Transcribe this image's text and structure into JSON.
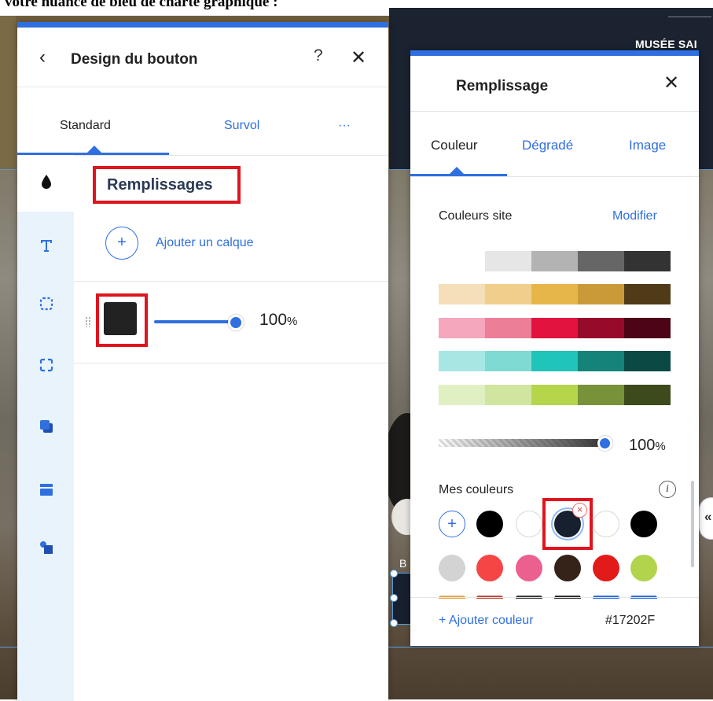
{
  "caption": "votre nuance de bleu de charte graphique :",
  "background": {
    "brand_text": "MUSÉE SAI",
    "button_label": "B",
    "side_handle": "«"
  },
  "design_panel": {
    "title": "Design du bouton",
    "help": "?",
    "close": "✕",
    "back": "‹",
    "tabs": [
      "Standard",
      "Survol",
      "···"
    ],
    "section_title": "Remplissages",
    "add_layer_label": "Ajouter un calque",
    "add_symbol": "+",
    "layer": {
      "color": "#222222",
      "opacity": "100",
      "opacity_unit": "%"
    },
    "sidebar_icons": [
      "fill-icon",
      "text-icon",
      "border-icon",
      "corners-icon",
      "shadow-icon",
      "layout-icon",
      "shapes-icon"
    ]
  },
  "fill_panel": {
    "title": "Remplissage",
    "close": "✕",
    "tabs": [
      "Couleur",
      "Dégradé",
      "Image"
    ],
    "site_colors_label": "Couleurs site",
    "edit_label": "Modifier",
    "palettes": [
      [
        "#ffffff",
        "#e6e6e6",
        "#b3b3b3",
        "#666666",
        "#333333"
      ],
      [
        "#f5dfb9",
        "#f0cf8d",
        "#e7b64a",
        "#c99b38",
        "#4f3b18"
      ],
      [
        "#f4a7bd",
        "#ec7e98",
        "#e2133e",
        "#970b2a",
        "#4d0416"
      ],
      [
        "#a6e7e4",
        "#7fdad3",
        "#21c4b8",
        "#168379",
        "#0a4944"
      ],
      [
        "#e1f0c2",
        "#d0e5a0",
        "#b5d54a",
        "#78923a",
        "#3d4a1c"
      ]
    ],
    "opacity": "100",
    "opacity_unit": "%",
    "my_colors_label": "Mes couleurs",
    "info_symbol": "i",
    "my_colors": [
      [
        "add",
        "#000000",
        "#ffffff",
        "#17202f",
        "#ffffff",
        "#000000"
      ],
      [
        "#d3d3d3",
        "#f64545",
        "#ec6090",
        "#352218",
        "#e21a1a",
        "#b2d44c"
      ]
    ],
    "selected_color_index": 3,
    "remove_symbol": "×",
    "add_color_label": "+ Ajouter couleur",
    "hex_value": "#17202F"
  },
  "colors": {
    "accent": "#2f6fe0",
    "highlight": "#e0141e"
  }
}
